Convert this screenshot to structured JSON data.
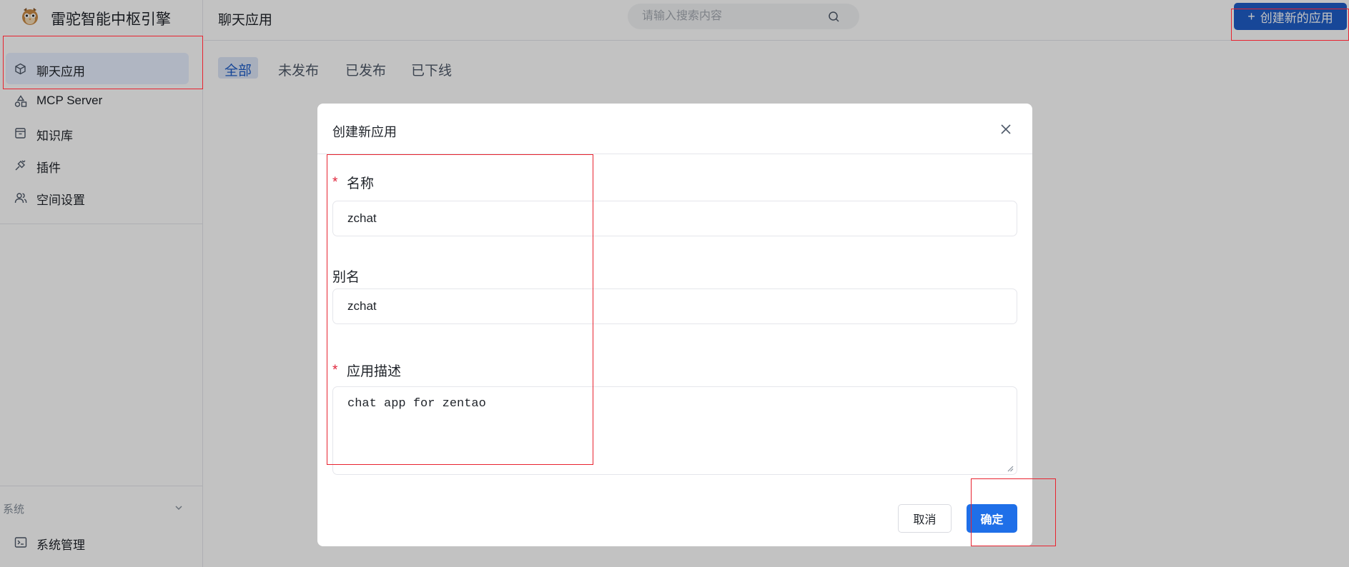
{
  "brand": {
    "title": "雷驼智能中枢引擎",
    "logo_icon": "owl-logo"
  },
  "sidebar": {
    "items": [
      {
        "label": "聊天应用",
        "icon": "cube-icon",
        "active": true
      },
      {
        "label": "MCP Server",
        "icon": "shapes-icon",
        "active": false
      },
      {
        "label": "知识库",
        "icon": "archive-icon",
        "active": false
      },
      {
        "label": "插件",
        "icon": "plug-icon",
        "active": false
      },
      {
        "label": "空间设置",
        "icon": "users-icon",
        "active": false
      }
    ],
    "system_group": {
      "label": "系统",
      "icon": "chevron-down-icon"
    },
    "system_items": [
      {
        "label": "系统管理",
        "icon": "terminal-icon"
      }
    ]
  },
  "topbar": {
    "title": "聊天应用",
    "search_placeholder": "请输入搜索内容",
    "create_button": "创建新的应用"
  },
  "tabs": [
    {
      "label": "全部",
      "active": true
    },
    {
      "label": "未发布",
      "active": false
    },
    {
      "label": "已发布",
      "active": false
    },
    {
      "label": "已下线",
      "active": false
    }
  ],
  "modal": {
    "title": "创建新应用",
    "fields": {
      "name": {
        "label": "名称",
        "required": true,
        "value": "zchat"
      },
      "alias": {
        "label": "别名",
        "required": false,
        "value": "zchat"
      },
      "description": {
        "label": "应用描述",
        "required": true,
        "value": "chat app for zentao"
      }
    },
    "cancel_label": "取消",
    "confirm_label": "确定"
  },
  "colors": {
    "primary": "#1f5ec8",
    "confirm": "#1f6fe8",
    "required_star": "#e0243a",
    "annotation": "#e8232f",
    "overlay": "rgba(0,0,0,0.24)"
  }
}
